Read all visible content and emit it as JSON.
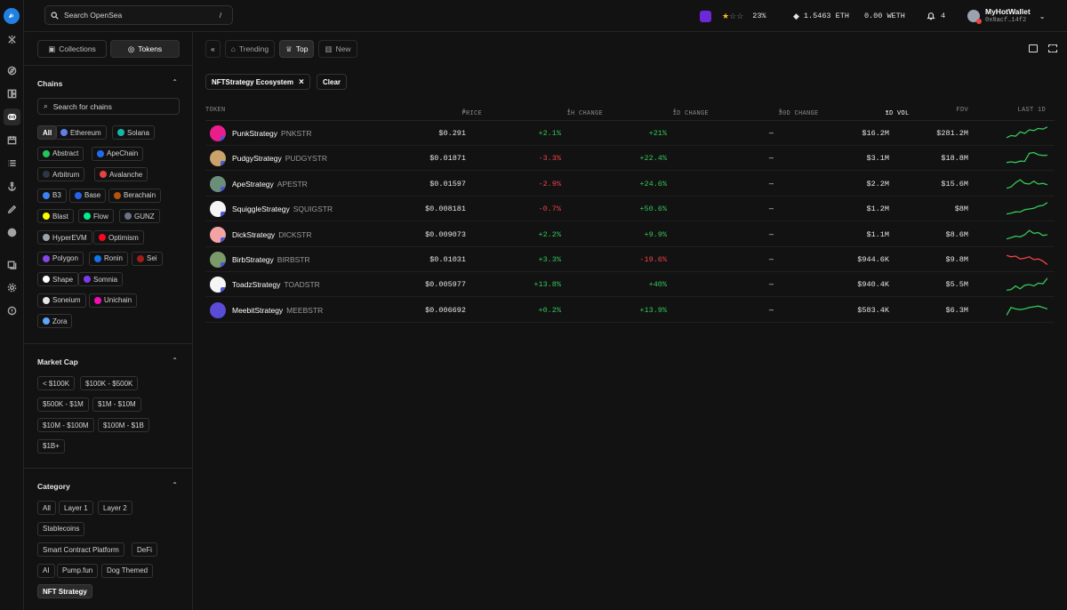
{
  "search": {
    "placeholder": "Search OpenSea",
    "shortcut": "/"
  },
  "header": {
    "xp_percent": "23%",
    "eth_balance": "1.5463 ETH",
    "weth_balance": "0.00 WETH",
    "notifications": "4",
    "wallet_name": "MyHotWallet",
    "wallet_address": "0x8acf…14f2"
  },
  "sidebar": {
    "tabs": {
      "collections": "Collections",
      "tokens": "Tokens"
    },
    "chains": {
      "title": "Chains",
      "search_placeholder": "Search for chains",
      "items": [
        {
          "label": "All",
          "color": ""
        },
        {
          "label": "Ethereum",
          "color": "#627eea"
        },
        {
          "label": "Solana",
          "color": "#14b8a6"
        },
        {
          "label": "Abstract",
          "color": "#22c55e"
        },
        {
          "label": "ApeChain",
          "color": "#1e6df0"
        },
        {
          "label": "Arbitrum",
          "color": "#2d3748"
        },
        {
          "label": "Avalanche",
          "color": "#e84142"
        },
        {
          "label": "B3",
          "color": "#3b82f6"
        },
        {
          "label": "Base",
          "color": "#2563eb"
        },
        {
          "label": "Berachain",
          "color": "#b45309"
        },
        {
          "label": "Blast",
          "color": "#fcfc03"
        },
        {
          "label": "Flow",
          "color": "#00ef8b"
        },
        {
          "label": "GUNZ",
          "color": "#6b7280"
        },
        {
          "label": "HyperEVM",
          "color": "#9ca3af"
        },
        {
          "label": "Optimism",
          "color": "#ff0420"
        },
        {
          "label": "Polygon",
          "color": "#8247e5"
        },
        {
          "label": "Ronin",
          "color": "#1273ea"
        },
        {
          "label": "Sei",
          "color": "#9e1f19"
        },
        {
          "label": "Shape",
          "color": "#ffffff"
        },
        {
          "label": "Somnia",
          "color": "#7c3aed"
        },
        {
          "label": "Soneium",
          "color": "#e5e5e5"
        },
        {
          "label": "Unichain",
          "color": "#f50db4"
        },
        {
          "label": "Zora",
          "color": "#60a5fa"
        }
      ]
    },
    "market_cap": {
      "title": "Market Cap",
      "items": [
        "< $100K",
        "$100K - $500K",
        "$500K - $1M",
        "$1M - $10M",
        "$10M - $100M",
        "$100M - $1B",
        "$1B+"
      ]
    },
    "category": {
      "title": "Category",
      "items": [
        "All",
        "Layer 1",
        "Layer 2",
        "Stablecoins",
        "Smart Contract Platform",
        "DeFi",
        "AI",
        "Pump.fun",
        "Dog Themed",
        "NFT Strategy"
      ]
    }
  },
  "main": {
    "tabs": {
      "trending": "Trending",
      "top": "Top",
      "new": "New"
    },
    "filter": {
      "active": "NFTStrategy Ecosystem",
      "clear": "Clear"
    },
    "columns": {
      "token": "TOKEN",
      "price": "PRICE",
      "h1": "1H CHANGE",
      "d1": "1D CHANGE",
      "d30": "30D CHANGE",
      "vol": "1D VOL",
      "fdv": "FDV",
      "last": "LAST 1D"
    },
    "rows": [
      {
        "name": "PunkStrategy",
        "symbol": "PNKSTR",
        "price": "$0.291",
        "h1": "+2.1%",
        "d1": "+21%",
        "d30": "—",
        "vol": "$16.2M",
        "fdv": "$281.2M",
        "avatar": "#e91e8c",
        "trend": [
          0.2,
          0.35,
          0.3,
          0.6,
          0.5,
          0.75,
          0.7,
          0.85,
          0.8,
          0.95
        ]
      },
      {
        "name": "PudgyStrategy",
        "symbol": "PUDGYSTR",
        "price": "$0.01871",
        "h1": "-3.3%",
        "d1": "+22.4%",
        "d30": "—",
        "vol": "$3.1M",
        "fdv": "$18.8M",
        "avatar": "#c9a36b",
        "trend": [
          0.2,
          0.25,
          0.2,
          0.3,
          0.28,
          0.85,
          0.9,
          0.75,
          0.7,
          0.72
        ]
      },
      {
        "name": "ApeStrategy",
        "symbol": "APESTR",
        "price": "$0.01597",
        "h1": "-2.9%",
        "d1": "+24.6%",
        "d30": "—",
        "vol": "$2.2M",
        "fdv": "$15.6M",
        "avatar": "#6b8e7a",
        "trend": [
          0.2,
          0.3,
          0.6,
          0.8,
          0.55,
          0.5,
          0.7,
          0.5,
          0.55,
          0.45
        ]
      },
      {
        "name": "SquiggleStrategy",
        "symbol": "SQUIGSTR",
        "price": "$0.008181",
        "h1": "-0.7%",
        "d1": "+50.6%",
        "d30": "—",
        "vol": "$1.2M",
        "fdv": "$8M",
        "avatar": "#f5f5f5",
        "trend": [
          0.15,
          0.2,
          0.3,
          0.28,
          0.45,
          0.5,
          0.55,
          0.7,
          0.75,
          0.95
        ]
      },
      {
        "name": "DickStrategy",
        "symbol": "DICKSTR",
        "price": "$0.009073",
        "h1": "+2.2%",
        "d1": "+9.9%",
        "d30": "—",
        "vol": "$1.1M",
        "fdv": "$8.6M",
        "avatar": "#f4a3a3",
        "trend": [
          0.2,
          0.3,
          0.4,
          0.35,
          0.5,
          0.8,
          0.6,
          0.65,
          0.45,
          0.5
        ]
      },
      {
        "name": "BirbStrategy",
        "symbol": "BIRBSTR",
        "price": "$0.01031",
        "h1": "+3.3%",
        "d1": "-19.6%",
        "d30": "—",
        "vol": "$944.6K",
        "fdv": "$9.8M",
        "avatar": "#7a9a6a",
        "trend": [
          0.8,
          0.7,
          0.75,
          0.55,
          0.6,
          0.7,
          0.5,
          0.55,
          0.4,
          0.15
        ]
      },
      {
        "name": "ToadzStrategy",
        "symbol": "TOADSTR",
        "price": "$0.005977",
        "h1": "+13.8%",
        "d1": "+40%",
        "d30": "—",
        "vol": "$940.4K",
        "fdv": "$5.5M",
        "avatar": "#f5f5f5",
        "trend": [
          0.1,
          0.15,
          0.4,
          0.2,
          0.45,
          0.5,
          0.4,
          0.6,
          0.55,
          0.95
        ]
      },
      {
        "name": "MeebitStrategy",
        "symbol": "MEEBSTR",
        "price": "$0.006692",
        "h1": "+0.2%",
        "d1": "+13.9%",
        "d30": "—",
        "vol": "$583.4K",
        "fdv": "$6.3M",
        "avatar": "#5b4bd6",
        "trend": [
          0.15,
          0.7,
          0.6,
          0.55,
          0.6,
          0.7,
          0.75,
          0.8,
          0.7,
          0.6
        ]
      }
    ]
  }
}
